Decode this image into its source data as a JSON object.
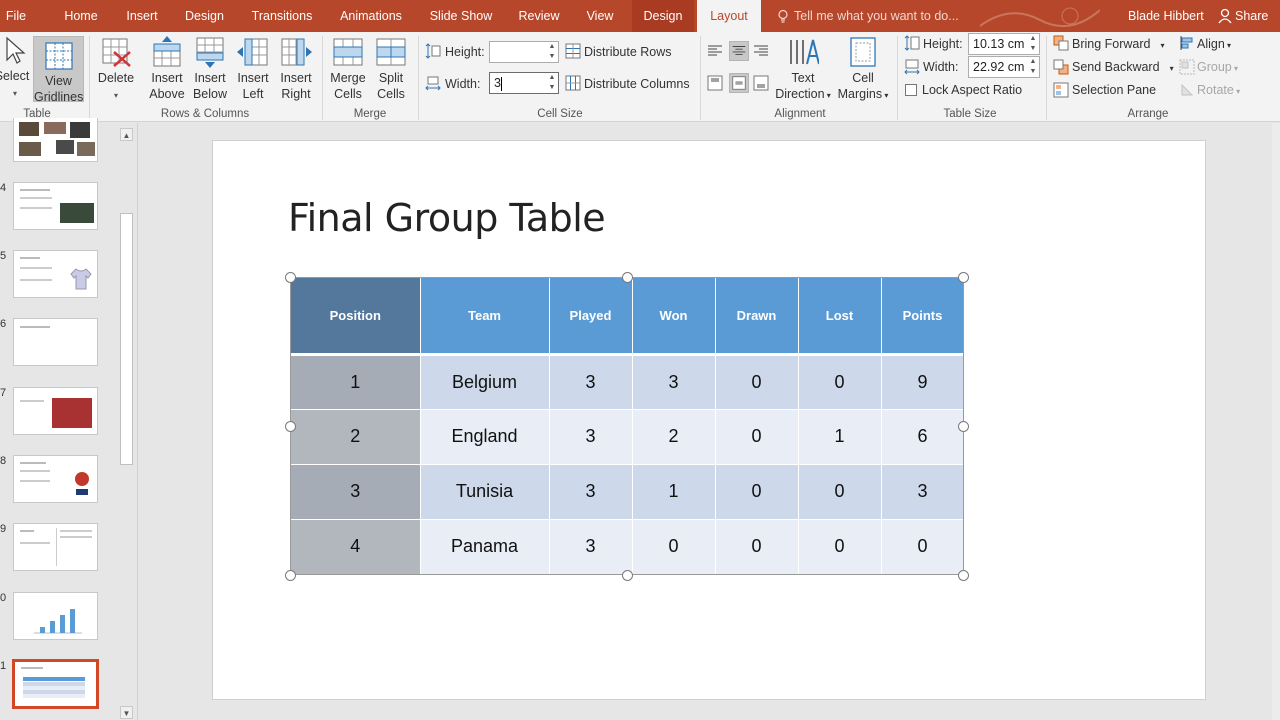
{
  "tabs": {
    "file": "File",
    "home": "Home",
    "insert": "Insert",
    "design": "Design",
    "transitions": "Transitions",
    "animations": "Animations",
    "slideshow": "Slide Show",
    "review": "Review",
    "view": "View",
    "table_design": "Design",
    "layout": "Layout",
    "tell_me": "Tell me what you want to do...",
    "user": "Blade Hibbert",
    "share": "Share"
  },
  "ribbon": {
    "groups": {
      "table": "Table",
      "rows_columns": "Rows & Columns",
      "merge": "Merge",
      "cell_size": "Cell Size",
      "alignment": "Alignment",
      "table_size": "Table Size",
      "arrange": "Arrange"
    },
    "select": "Select",
    "view_gridlines_1": "View",
    "view_gridlines_2": "Gridlines",
    "delete": "Delete",
    "insert_above_1": "Insert",
    "insert_above_2": "Above",
    "insert_below_1": "Insert",
    "insert_below_2": "Below",
    "insert_left_1": "Insert",
    "insert_left_2": "Left",
    "insert_right_1": "Insert",
    "insert_right_2": "Right",
    "merge_cells_1": "Merge",
    "merge_cells_2": "Cells",
    "split_cells_1": "Split",
    "split_cells_2": "Cells",
    "cell_height_label": "Height:",
    "cell_height_value": "",
    "cell_width_label": "Width:",
    "cell_width_value": "3",
    "distribute_rows": "Distribute Rows",
    "distribute_columns": "Distribute Columns",
    "text_direction_1": "Text",
    "text_direction_2": "Direction",
    "cell_margins_1": "Cell",
    "cell_margins_2": "Margins",
    "table_height_label": "Height:",
    "table_height_value": "10.13 cm",
    "table_width_label": "Width:",
    "table_width_value": "22.92 cm",
    "lock_aspect": "Lock Aspect Ratio",
    "bring_forward": "Bring Forward",
    "send_backward": "Send Backward",
    "selection_pane": "Selection Pane",
    "align": "Align",
    "group": "Group",
    "rotate": "Rotate"
  },
  "thumbnails": [
    {
      "num": "",
      "kind": "photos"
    },
    {
      "num": "4",
      "kind": "text-photo"
    },
    {
      "num": "5",
      "kind": "text-shirt"
    },
    {
      "num": "6",
      "kind": "text"
    },
    {
      "num": "7",
      "kind": "team-photo"
    },
    {
      "num": "8",
      "kind": "text-logo"
    },
    {
      "num": "9",
      "kind": "two-column"
    },
    {
      "num": "0",
      "kind": "chart"
    },
    {
      "num": "1",
      "kind": "table",
      "selected": true
    }
  ],
  "slide": {
    "title": "Final Group Table",
    "table": {
      "headers": [
        "Position",
        "Team",
        "Played",
        "Won",
        "Drawn",
        "Lost",
        "Points"
      ],
      "rows": [
        [
          "1",
          "Belgium",
          "3",
          "3",
          "0",
          "0",
          "9"
        ],
        [
          "2",
          "England",
          "3",
          "2",
          "0",
          "1",
          "6"
        ],
        [
          "3",
          "Tunisia",
          "3",
          "1",
          "0",
          "0",
          "3"
        ],
        [
          "4",
          "Panama",
          "3",
          "0",
          "0",
          "0",
          "0"
        ]
      ]
    }
  },
  "colors": {
    "accent": "#b7472a",
    "header": "#5b9bd5",
    "header_first": "#53789c",
    "row_odd": "#cdd9ea",
    "row_even": "#e8edf6",
    "col_first": "#a5acb6"
  }
}
